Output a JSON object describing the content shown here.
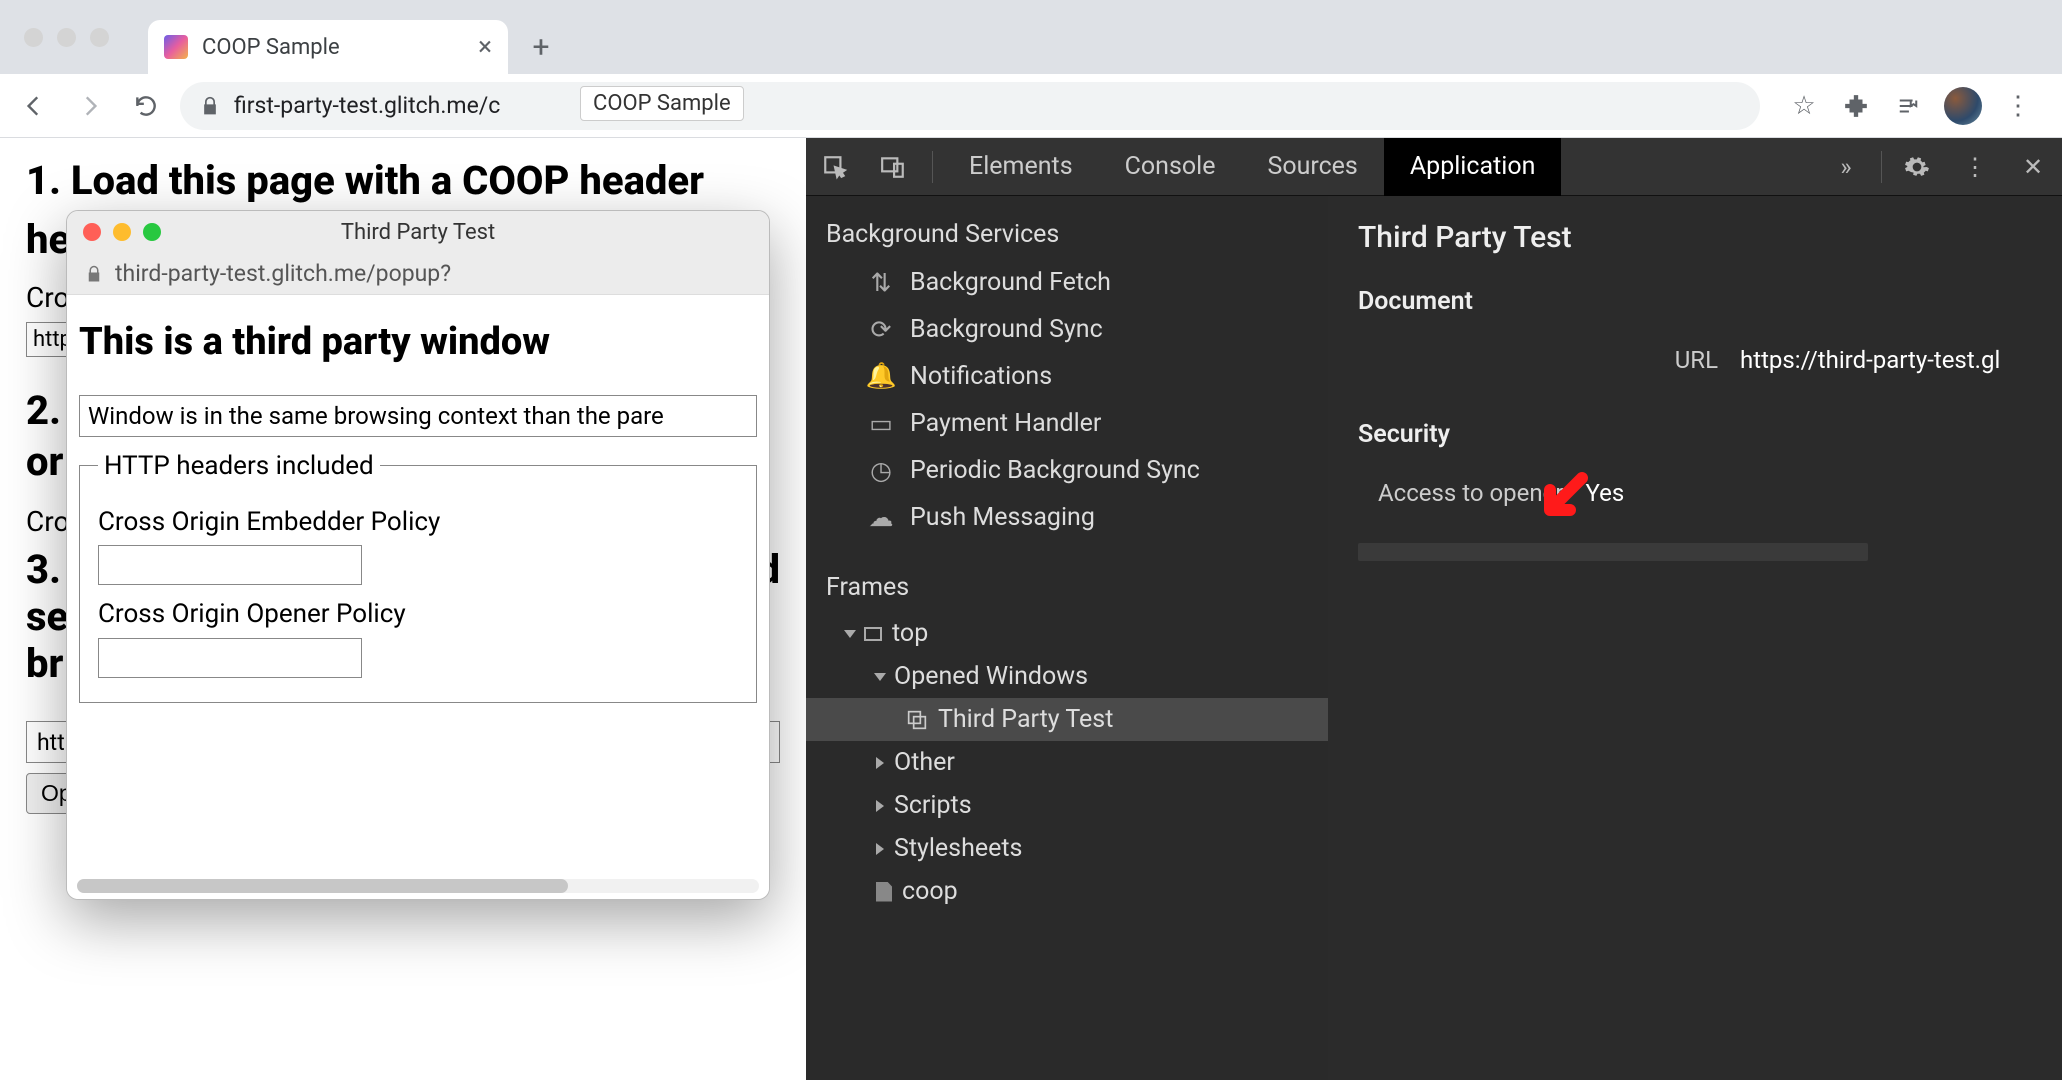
{
  "browser": {
    "tab_title": "COOP Sample",
    "url": "first-party-test.glitch.me/c",
    "url_tooltip": "COOP Sample",
    "actions": {
      "star": "☆",
      "ext": "✦",
      "queue": "≡",
      "menu": "⋮"
    }
  },
  "page": {
    "h1": "1. Load this page with a COOP header",
    "partial_cro1": "Cro",
    "partial_http": "http",
    "h2": "2.",
    "h2b": "or",
    "partial_cro2": "Cro",
    "h3a": "3.",
    "h3b": "se",
    "h3c": "br",
    "h3_right": "d",
    "url_value": "https://third-party-test.glitch.me/popup?",
    "button": "Open a popup"
  },
  "popup": {
    "title": "Third Party Test",
    "url": "third-party-test.glitch.me/popup?",
    "heading": "This is a third party window",
    "context_msg": "Window is in the same browsing context than the pare",
    "legend": "HTTP headers included",
    "coep_label": "Cross Origin Embedder Policy",
    "coop_label": "Cross Origin Opener Policy"
  },
  "devtools": {
    "tabs": {
      "elements": "Elements",
      "console": "Console",
      "sources": "Sources",
      "application": "Application"
    },
    "side": {
      "bg_services": "Background Services",
      "items": {
        "fetch": "Background Fetch",
        "sync": "Background Sync",
        "notif": "Notifications",
        "payment": "Payment Handler",
        "periodic": "Periodic Background Sync",
        "push": "Push Messaging"
      },
      "frames": "Frames",
      "top": "top",
      "opened": "Opened Windows",
      "thirdparty": "Third Party Test",
      "other": "Other",
      "scripts": "Scripts",
      "stylesheets": "Stylesheets",
      "coop": "coop"
    },
    "main": {
      "title": "Third Party Test",
      "document": "Document",
      "url_label": "URL",
      "url_value": "https://third-party-test.gl",
      "security": "Security",
      "access_label": "Access to opener",
      "access_value": "Yes"
    }
  }
}
